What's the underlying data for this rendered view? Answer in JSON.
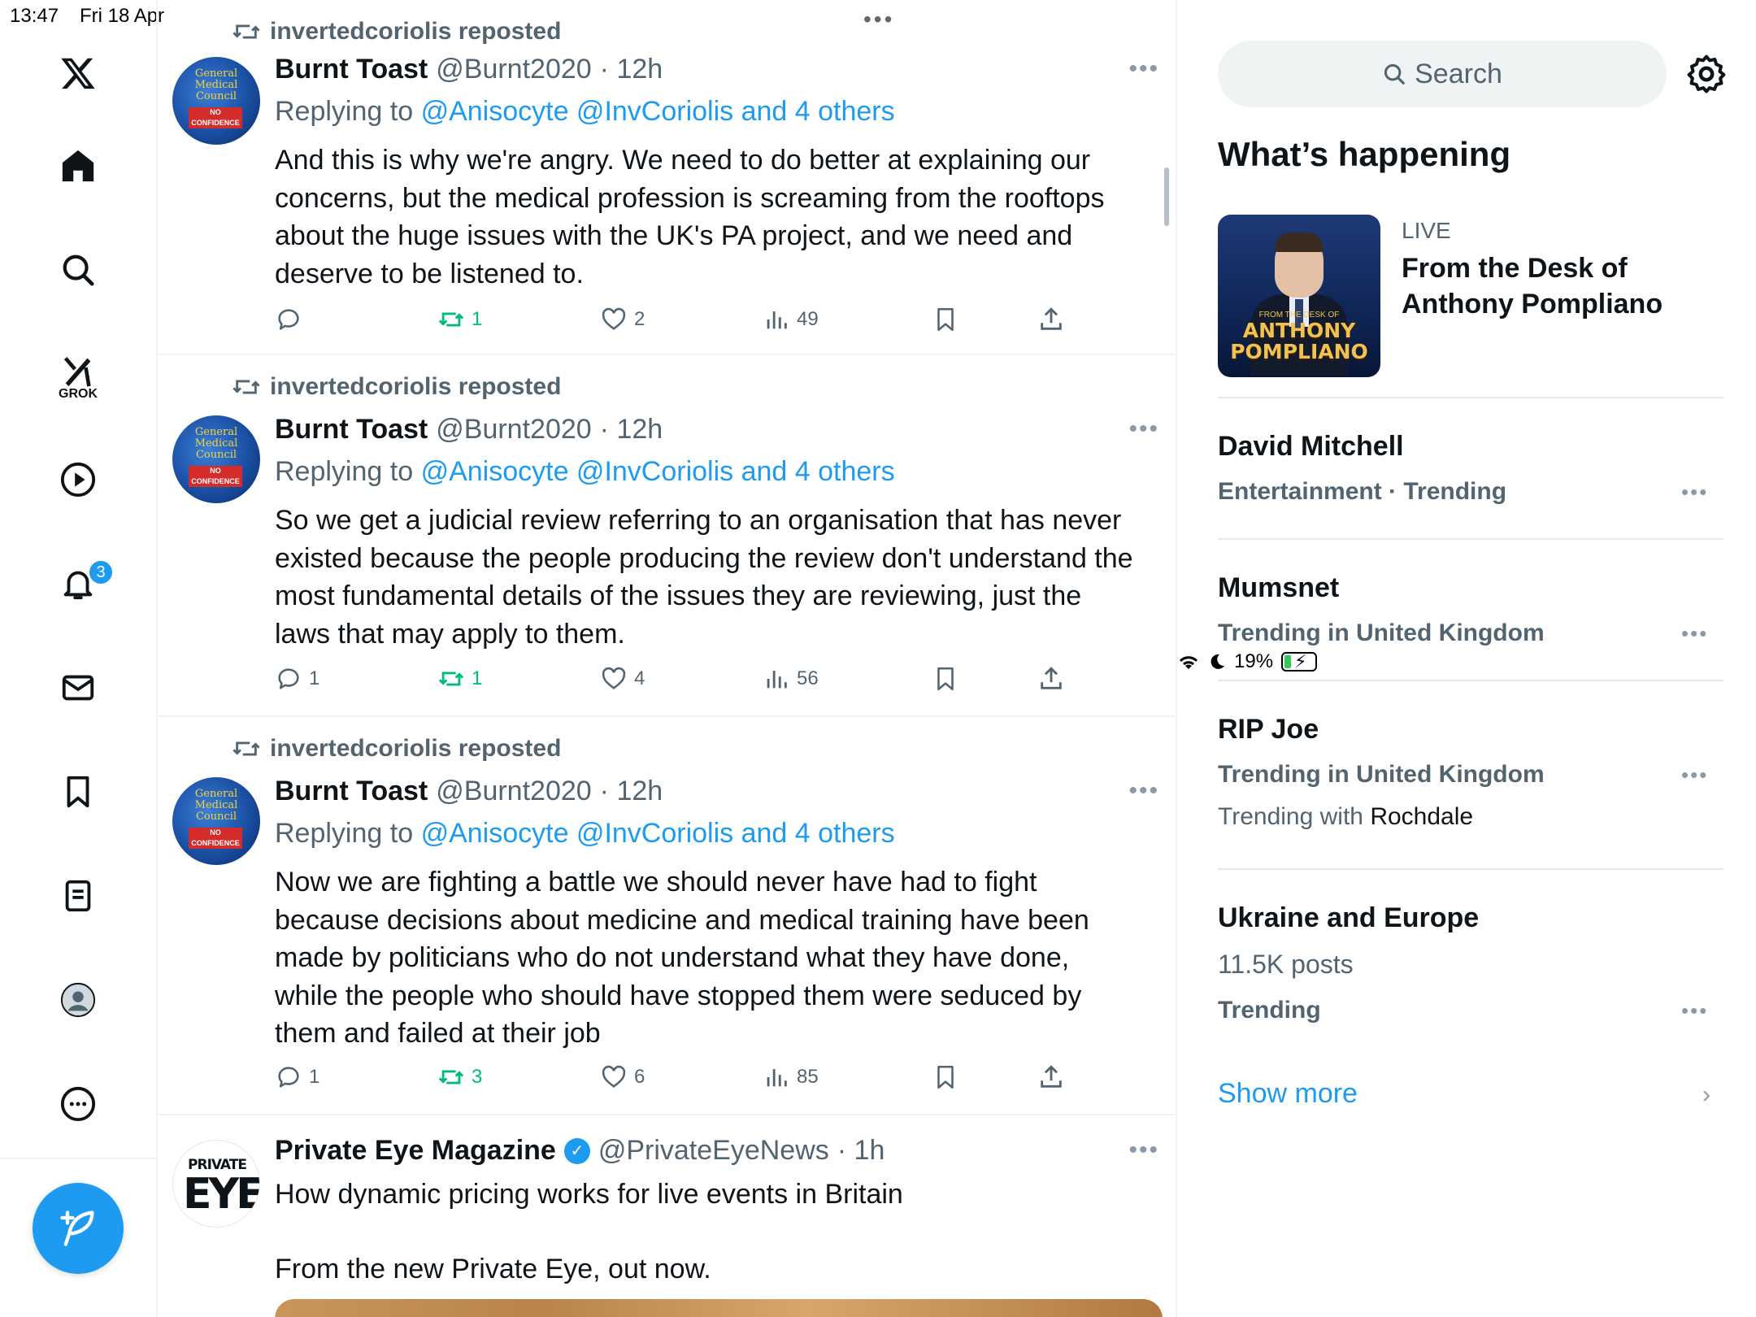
{
  "status": {
    "time": "13:47",
    "date": "Fri 18 Apr",
    "battery": "19%"
  },
  "nav": {
    "grok_label": "GROK",
    "notification_count": "3"
  },
  "timeline": {
    "tweets": [
      {
        "repost_by": "invertedcoriolis reposted",
        "name": "Burnt Toast",
        "handle": "@Burnt2020",
        "time": "· 12h",
        "reply_prefix": "Replying to",
        "reply_targets": "@Anisocyte @InvCoriolis and 4 others",
        "text": "And this is why we're angry. We need to do better at explaining our concerns, but the medical profession is screaming from the rooftops about the huge issues with the UK's PA project, and we need and deserve to be listened to.",
        "replies": "",
        "reposts": "1",
        "likes": "2",
        "views": "49"
      },
      {
        "repost_by": "invertedcoriolis reposted",
        "name": "Burnt Toast",
        "handle": "@Burnt2020",
        "time": "· 12h",
        "reply_prefix": "Replying to",
        "reply_targets": "@Anisocyte @InvCoriolis and 4 others",
        "text": "So we get a judicial review referring to an organisation that has never existed because the people producing the review don't understand the most fundamental details of the issues they are reviewing, just the laws that may apply to them.",
        "replies": "1",
        "reposts": "1",
        "likes": "4",
        "views": "56"
      },
      {
        "repost_by": "invertedcoriolis reposted",
        "name": "Burnt Toast",
        "handle": "@Burnt2020",
        "time": "· 12h",
        "reply_prefix": "Replying to",
        "reply_targets": "@Anisocyte @InvCoriolis and 4 others",
        "text": "Now we are fighting a battle we should never have had to fight because decisions about medicine and medical training have been made by politicians who do not understand what they have done, while the people who should have stopped them were seduced by them and failed at their job",
        "replies": "1",
        "reposts": "3",
        "likes": "6",
        "views": "85"
      },
      {
        "name": "Private Eye Magazine",
        "handle": "@PrivateEyeNews",
        "time": "· 1h",
        "text_line1": "How dynamic pricing works for live events in Britain",
        "text_line2": "From the new Private Eye, out now."
      }
    ],
    "avatar_gmc": {
      "line1": "General",
      "line2": "Medical",
      "line3": "Council",
      "stamp1": "NO",
      "stamp2": "CONFIDENCE"
    },
    "avatar_pe": {
      "top": "PRIVATE",
      "bottom": "EYE"
    }
  },
  "sidebar": {
    "search_placeholder": "Search",
    "whats_happening": "What’s happening",
    "live": {
      "label": "LIVE",
      "title": "From the Desk of Anthony Pompliano",
      "thumb_small": "FROM THE DESK OF",
      "thumb_big1": "ANTHONY",
      "thumb_big2": "POMPLIANO"
    },
    "trends": [
      {
        "name": "David Mitchell",
        "meta": "Entertainment · Trending"
      },
      {
        "name": "Mumsnet",
        "meta": "Trending in United Kingdom"
      },
      {
        "name": "RIP Joe",
        "meta": "Trending in United Kingdom",
        "with_prefix": "Trending with",
        "with_topic": "Rochdale"
      },
      {
        "name": "Ukraine and Europe",
        "posts": "11.5K posts",
        "meta": "Trending"
      }
    ],
    "show_more": "Show more"
  }
}
